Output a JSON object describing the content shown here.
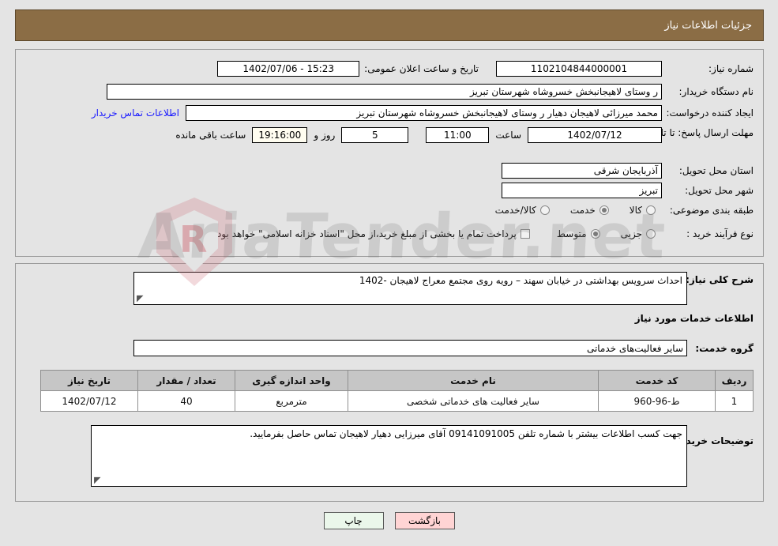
{
  "header": {
    "title": "جزئیات اطلاعات نیاز"
  },
  "info": {
    "need_number_label": "شماره نیاز:",
    "need_number_value": "1102104844000001",
    "announce_label": "تاریخ و ساعت اعلان عمومی:",
    "announce_value": "15:23 - 1402/07/06",
    "buyer_org_label": "نام دستگاه خریدار:",
    "buyer_org_value": "ر وستای لاهیجانبخش خسروشاه شهرستان تبریز",
    "creator_label": "ایجاد کننده درخواست:",
    "creator_value": "محمد میرزائی لاهیجان دهیار ر وستای لاهیجانبخش خسروشاه شهرستان تبریز",
    "contact_link": "اطلاعات تماس خریدار",
    "deadline_label": "مهلت ارسال پاسخ: تا تاریخ:",
    "deadline_date": "1402/07/12",
    "hour_label": "ساعت",
    "deadline_time": "11:00",
    "days_value": "5",
    "days_label": "روز و",
    "remaining_time": "19:16:00",
    "remaining_label": "ساعت باقی مانده",
    "province_label": "استان محل تحویل:",
    "province_value": "آذربایجان شرقی",
    "city_label": "شهر محل تحویل:",
    "city_value": "تبریز",
    "category_label": "طبقه بندی موضوعی:",
    "category_options": [
      {
        "label": "کالا",
        "selected": false
      },
      {
        "label": "خدمت",
        "selected": true
      },
      {
        "label": "کالا/خدمت",
        "selected": false
      }
    ],
    "process_label": "نوع فرآیند خرید :",
    "process_options": [
      {
        "label": "جزیی",
        "selected": false
      },
      {
        "label": "متوسط",
        "selected": true
      }
    ],
    "treasury_checkbox_label": "پرداخت تمام یا بخشی از مبلغ خرید،از محل \"اسناد خزانه اسلامی\" خواهد بود.",
    "treasury_checked": false
  },
  "description": {
    "general_label": "شرح کلی نیاز:",
    "general_value": "احداث سرویس بهداشتی در خیابان سهند – رویه روی مجتمع معراج لاهیجان  -1402",
    "services_heading": "اطلاعات خدمات مورد نیاز",
    "service_group_label": "گروه خدمت:",
    "service_group_value": "سایر فعالیت‌های خدماتی",
    "buyer_notes_label": "توضیحات خریدار:",
    "buyer_notes_value": "جهت کسب اطلاعات بیشتر با شماره تلفن  09141091005  آقای میرزایی دهیار لاهیجان تماس حاصل بفرمایید."
  },
  "table": {
    "columns": [
      "ردیف",
      "کد خدمت",
      "نام خدمت",
      "واحد اندازه گیری",
      "تعداد / مقدار",
      "تاریخ نیاز"
    ],
    "rows": [
      {
        "index": "1",
        "code": "ط-96-960",
        "name": "سایر فعالیت های خدماتی شخصی",
        "unit": "مترمربع",
        "quantity": "40",
        "date": "1402/07/12"
      }
    ]
  },
  "footer": {
    "back_label": "بازگشت",
    "print_label": "چاپ"
  },
  "watermark": {
    "text": "AriaTender.net",
    "mark": "R"
  },
  "colors": {
    "header_bg": "#8b6d45",
    "page_bg": "#e4e4e4",
    "link": "#1a1aff",
    "back_btn": "#ffd4d4",
    "print_btn": "#ebf7eb"
  }
}
